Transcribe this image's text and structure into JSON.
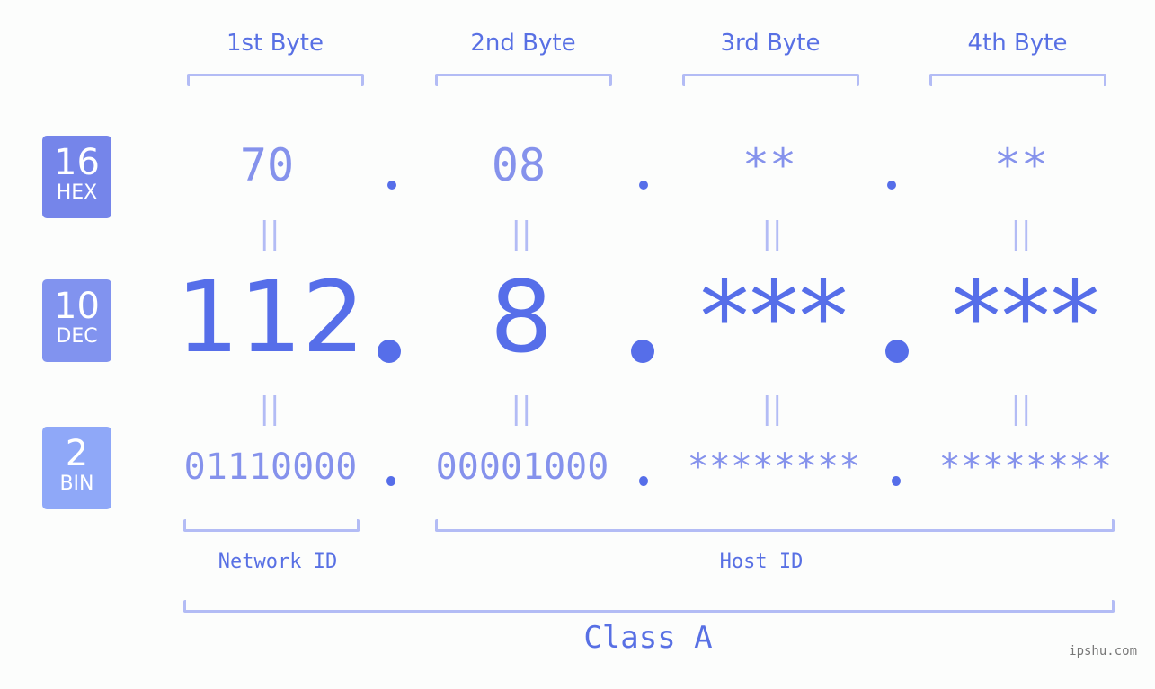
{
  "byte_headers": [
    "1st Byte",
    "2nd Byte",
    "3rd Byte",
    "4th Byte"
  ],
  "rows": {
    "hex": {
      "base": "16",
      "label": "HEX",
      "color": "#7585ea",
      "values": [
        "70",
        "08",
        "**",
        "**"
      ]
    },
    "dec": {
      "base": "10",
      "label": "DEC",
      "color": "#8193ef",
      "values": [
        "112",
        "8",
        "***",
        "***"
      ]
    },
    "bin": {
      "base": "2",
      "label": "BIN",
      "color": "#8fa8f8",
      "values": [
        "01110000",
        "00001000",
        "********",
        "********"
      ]
    }
  },
  "equals_sign": "||",
  "network_id_label": "Network ID",
  "host_id_label": "Host ID",
  "class_label": "Class A",
  "watermark": "ipshu.com",
  "colors": {
    "accent": "#566ee9",
    "light_accent": "#8592ec",
    "bracket": "#b3bcf5"
  }
}
